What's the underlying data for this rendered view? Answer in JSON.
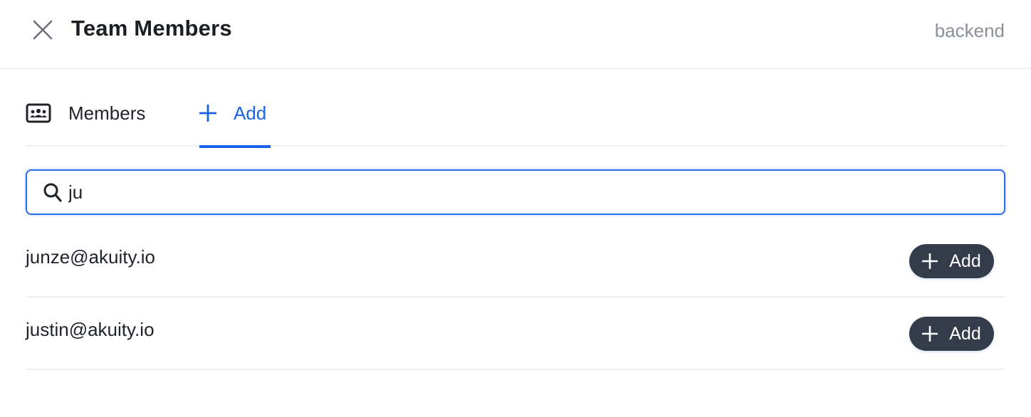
{
  "header": {
    "title": "Team Members",
    "context": "backend",
    "close_icon": "close-icon"
  },
  "tabs": [
    {
      "label": "Members",
      "icon": "members-card-icon",
      "active": false
    },
    {
      "label": "Add",
      "icon": "plus-icon",
      "active": true
    }
  ],
  "search": {
    "icon": "search-icon",
    "value": "ju",
    "placeholder": ""
  },
  "results": [
    {
      "email": "junze@akuity.io",
      "action_label": "Add",
      "action_icon": "plus-icon"
    },
    {
      "email": "justin@akuity.io",
      "action_label": "Add",
      "action_icon": "plus-icon"
    }
  ],
  "colors": {
    "accent": "#1a63e8",
    "button_bg": "#343c4a",
    "muted_text": "#8a9099",
    "divider": "#eceef1"
  }
}
